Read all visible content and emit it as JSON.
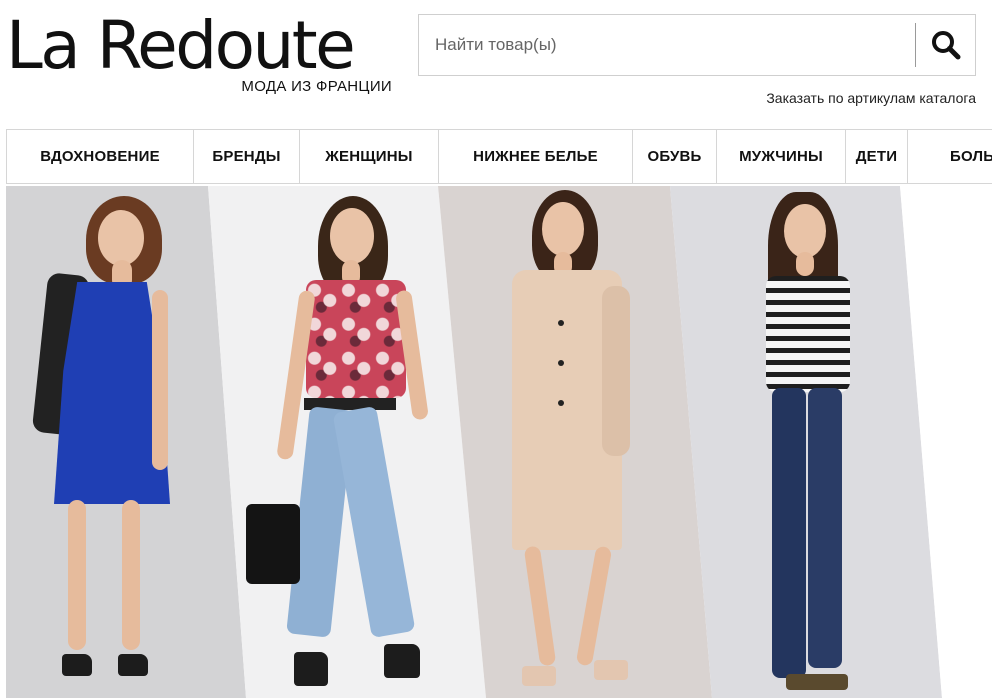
{
  "brand": {
    "name": "La Redoute",
    "tagline": "МОДА ИЗ ФРАНЦИИ"
  },
  "search": {
    "placeholder": "Найти товар(ы)",
    "icon": "search-icon"
  },
  "catalog_link": "Заказать по артикулам каталога",
  "nav": {
    "items": [
      {
        "label": "ВДОХНОВЕНИЕ"
      },
      {
        "label": "БРЕНДЫ"
      },
      {
        "label": "ЖЕНЩИНЫ"
      },
      {
        "label": "НИЖНЕЕ БЕЛЬЕ"
      },
      {
        "label": "ОБУВЬ"
      },
      {
        "label": "МУЖЧИНЫ"
      },
      {
        "label": "ДЕТИ"
      },
      {
        "label": "БОЛЬ"
      }
    ]
  },
  "hero": {
    "models": [
      {
        "outfit": "blue dress",
        "accent": "#1f3fb4"
      },
      {
        "outfit": "printed top and jeans",
        "accent": "#c9455a"
      },
      {
        "outfit": "beige trench coat",
        "accent": "#e7cdb6"
      },
      {
        "outfit": "striped top and jeans",
        "accent": "#23355e"
      }
    ]
  }
}
